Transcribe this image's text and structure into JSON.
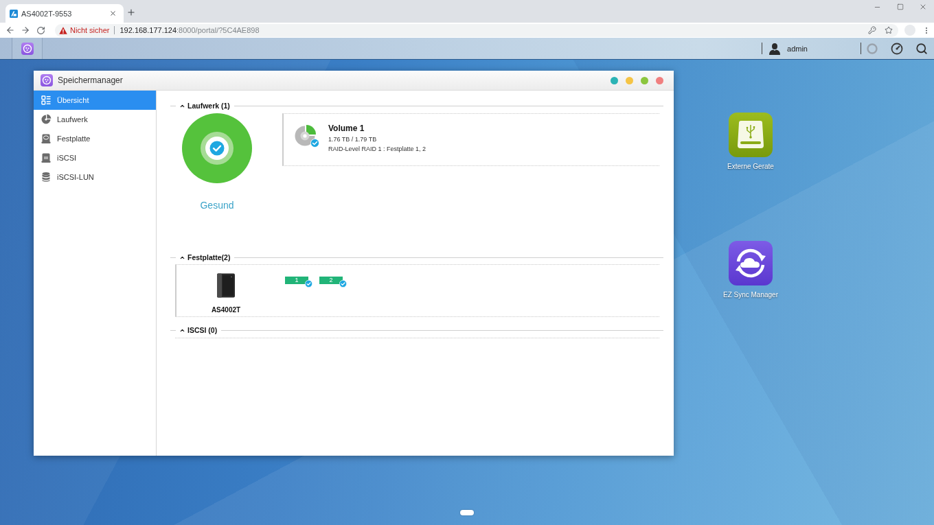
{
  "browser": {
    "tabs": [
      {
        "title": "AS4002T-9553",
        "selected": true
      }
    ],
    "address": {
      "warning": "Nicht sicher",
      "host": "192.168.177.124",
      "path": ":8000/portal/?5C4AE898"
    }
  },
  "taskbar": {
    "user": "admin"
  },
  "window": {
    "title": "Speichermanager",
    "controls": [
      {
        "color": "#2bb3b5"
      },
      {
        "color": "#f5c445"
      },
      {
        "color": "#8cc63e"
      },
      {
        "color": "#f07f7f"
      }
    ],
    "sidebar": {
      "items": [
        {
          "label": "Übersicht",
          "kind": "overview",
          "selected": true
        },
        {
          "label": "Laufwerk",
          "kind": "volume",
          "selected": false
        },
        {
          "label": "Festplatte",
          "kind": "disk",
          "selected": false
        },
        {
          "label": "iSCSI",
          "kind": "iscsi",
          "selected": false
        },
        {
          "label": "iSCSI-LUN",
          "kind": "lun",
          "selected": false
        }
      ]
    },
    "sections": [
      {
        "kind": "volumes",
        "title": "Laufwerk (1)",
        "expanded": true,
        "status": {
          "label": "Gesund",
          "healthy": true
        },
        "volumes": [
          {
            "name": "Volume 1",
            "usage": "1.76 TB / 1.79 TB",
            "raid": "RAID-Level RAID 1 : Festplatte 1, 2",
            "healthy": true
          }
        ]
      },
      {
        "kind": "disks",
        "title": "Festplatte(2)",
        "expanded": true,
        "device": "AS4002T",
        "disks": [
          {
            "label": "1",
            "healthy": true
          },
          {
            "label": "2",
            "healthy": true
          }
        ]
      },
      {
        "kind": "iscsi",
        "title": "ISCSI (0)",
        "expanded": true
      }
    ]
  },
  "desktop": {
    "shortcuts": [
      {
        "label": "Externe Gerate",
        "kind": "usb"
      },
      {
        "label": "EZ Sync Manager",
        "kind": "sync"
      }
    ]
  }
}
